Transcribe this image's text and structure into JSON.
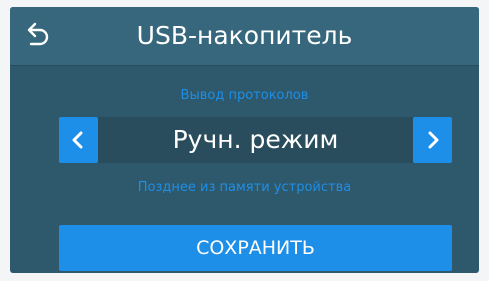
{
  "header": {
    "title": "USB-накопитель",
    "back_icon": "back-arrow-icon"
  },
  "setting": {
    "label": "Вывод протоколов",
    "value": "Ручн. режим",
    "prev_icon": "chevron-left-icon",
    "next_icon": "chevron-right-icon",
    "description": "Позднее из памяти устройства"
  },
  "actions": {
    "save_label": "СОХРАНИТЬ"
  },
  "colors": {
    "background": "#2e586b",
    "header": "#36677c",
    "accent": "#1e8fe8",
    "value_box": "#2a4d5d",
    "text": "#ffffff"
  }
}
